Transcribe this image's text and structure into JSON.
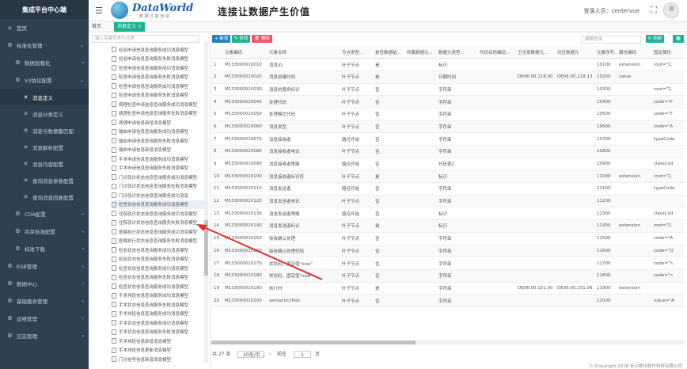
{
  "sidebar": {
    "brand": "集成平台中心端",
    "items": [
      {
        "label": "首页",
        "level": 1,
        "icon": "home-icon",
        "glyph": "⌂",
        "arrow": ""
      },
      {
        "label": "标准化管理",
        "level": 1,
        "icon": "gear-icon",
        "glyph": "⚙",
        "arrow": "⌄"
      },
      {
        "label": "数据加载化",
        "level": 2,
        "icon": "gear-icon",
        "glyph": "⚙",
        "arrow": "‹"
      },
      {
        "label": "V3协议配置",
        "level": 2,
        "icon": "gear-icon",
        "glyph": "⚙",
        "arrow": "⌄"
      },
      {
        "label": "消息定义",
        "level": 3,
        "icon": "tool-icon",
        "glyph": "✕",
        "arrow": "",
        "active": true
      },
      {
        "label": "消息分类定义",
        "level": 3,
        "icon": "tool-icon",
        "glyph": "✕",
        "arrow": ""
      },
      {
        "label": "消息与数据集匹配",
        "level": 3,
        "icon": "tool-icon",
        "glyph": "✕",
        "arrow": ""
      },
      {
        "label": "消息解析配置",
        "level": 3,
        "icon": "tool-icon",
        "glyph": "✕",
        "arrow": ""
      },
      {
        "label": "消息内容配置",
        "level": 3,
        "icon": "tool-icon",
        "glyph": "✕",
        "arrow": ""
      },
      {
        "label": "查询消息参数配置",
        "level": 3,
        "icon": "tool-icon",
        "glyph": "✕",
        "arrow": ""
      },
      {
        "label": "查询消息回复配置",
        "level": 3,
        "icon": "tool-icon",
        "glyph": "✕",
        "arrow": ""
      },
      {
        "label": "CDA配置",
        "level": 2,
        "icon": "gear-icon",
        "glyph": "⚙",
        "arrow": "‹"
      },
      {
        "label": "共享标准配置",
        "level": 2,
        "icon": "gear-icon",
        "glyph": "⚙",
        "arrow": "‹"
      },
      {
        "label": "标准下载",
        "level": 2,
        "icon": "gear-icon",
        "glyph": "⚙",
        "arrow": "‹"
      },
      {
        "label": "ESB管理",
        "level": 1,
        "icon": "gear-icon",
        "glyph": "⚙",
        "arrow": "‹"
      },
      {
        "label": "数据中心",
        "level": 1,
        "icon": "gear-icon",
        "glyph": "⚙",
        "arrow": "‹"
      },
      {
        "label": "基础服务管理",
        "level": 1,
        "icon": "gear-icon",
        "glyph": "⚙",
        "arrow": "‹"
      },
      {
        "label": "运维管理",
        "level": 1,
        "icon": "gear-icon",
        "glyph": "⚙",
        "arrow": "‹"
      },
      {
        "label": "日志管理",
        "level": 1,
        "icon": "gear-icon",
        "glyph": "⚙",
        "arrow": "‹"
      }
    ]
  },
  "header": {
    "logo_text": "DataWorld",
    "logo_sub": "数 据 才 能 创 造",
    "slogan": "连接让数据产生价值",
    "login_label": "登录人员：centervue"
  },
  "tabs": {
    "home": "首页",
    "current": "消息定义 ×"
  },
  "tree": {
    "placeholder": "输入关键字进行过滤",
    "nodes": [
      "检验申请信息查询服务成功消息模型",
      "检验申请信息查询服务失败消息模型",
      "检查申请信息查询服务成功消息模型",
      "检查申请信息查询服务失败消息模型",
      "检查申请信息查询服务成功消息模型",
      "检查申请信息查询服务失败消息模型",
      "病理检查申请信息查询服务成功消息模型",
      "病理检查申请信息查询服务失败消息模型",
      "病理申请信息新增消息模型",
      "输血申请信息查询服务成功消息模型",
      "输血申请信息查询服务失败消息模型",
      "输血申请信息新增消息模型",
      "手术申请信息查询服务成功消息模型",
      "手术申请信息查询服务失败消息模型",
      "门诊就诊状态信息查询服务成功消息模型",
      "门诊就诊状态信息查询服务失败消息模型",
      "门诊就诊状态信息查询服务成功消息",
      "检查状态信息查询服务成功消息模型",
      "住院就诊状态信息查询服务成功消息模型",
      "住院就诊状态信息查询服务失败消息模型",
      "医嘱执行状态信息查询服务成功消息模型",
      "医嘱执行状态信息查询服务失败消息模型",
      "检验状态信息查询服务成功消息模型",
      "检验状态信息查询服务失败消息模型",
      "检查状态信息查询服务成功消息模型",
      "检查状态信息查询服务失败消息模型",
      "检查状态信息查询服务成功消息模型",
      "手术排班信息查询服务成功消息模型",
      "手术状态信息查询服务失败消息模型",
      "手术排班信息查询服务成功消息模型",
      "手术状态信息查询服务成功消息模型",
      "手术状态信息查询服务失败消息模型",
      "手术排班信息新增消息模型",
      "手术排班信息更新消息模型",
      "门诊挂号信息新增消息模型"
    ],
    "selected": 17
  },
  "toolbar": {
    "add": "+ 新增",
    "edit": "✎ 修改",
    "del": "🗑 删除",
    "search_placeholder": "模糊查询",
    "search_btn": "⟳ 刷新",
    "cols_btn": "▦"
  },
  "table": {
    "headers": [
      "",
      "元素编码",
      "元素名称",
      "节点类型...",
      "是否数据结...",
      "所属数据元...",
      "数据元类型...",
      "代码名称编码...",
      "卫生部数据元...",
      "对应数据元",
      "元素序号...",
      "属性编码",
      "固定属性"
    ],
    "rows": [
      [
        "1",
        "M133000010010",
        "消息ID",
        "叶子节点",
        "是",
        "",
        "标识",
        "",
        "",
        "",
        "10100",
        "extension",
        "root=\"2."
      ],
      [
        "2",
        "M133000010020",
        "消息创建时间",
        "叶子节点",
        "是",
        "",
        "日期时间",
        "",
        "DE06.00.218.00",
        "DE06.00.218.13",
        "10200",
        "value",
        ""
      ],
      [
        "3",
        "M133000010030",
        "消息的服务标识",
        "叶子节点",
        "否",
        "",
        "字符串",
        "",
        "",
        "",
        "10300",
        "",
        "root=\"2."
      ],
      [
        "4",
        "M133000010040",
        "处理代码",
        "叶子节点",
        "否",
        "",
        "字符串",
        "",
        "",
        "",
        "10400",
        "",
        "code=\"P"
      ],
      [
        "5",
        "M133000010050",
        "处理模式代码",
        "叶子节点",
        "否",
        "",
        "字符串",
        "",
        "",
        "",
        "10500",
        "",
        "code=\"T"
      ],
      [
        "6",
        "M133000010060",
        "消息类型",
        "叶子节点",
        "否",
        "",
        "字符串",
        "",
        "",
        "",
        "10600",
        "",
        "code=\"A"
      ],
      [
        "7",
        "M133000010070",
        "消息接收者",
        "路径开始",
        "否",
        "",
        "字符串",
        "",
        "",
        "",
        "10700",
        "",
        "typeCode"
      ],
      [
        "8",
        "M133000010080",
        "消息接收者电讯",
        "叶子节点",
        "否",
        "",
        "字符串",
        "",
        "",
        "",
        "10800",
        "",
        ""
      ],
      [
        "9",
        "M133000010090",
        "消息接收者策略",
        "路径开始",
        "否",
        "",
        "代码表2",
        "",
        "",
        "",
        "10900",
        "",
        "classCod"
      ],
      [
        "10",
        "M133000010100",
        "消息接收者标识符",
        "叶子节点",
        "是",
        "",
        "标识",
        "",
        "",
        "",
        "11000",
        "extension",
        "root=\"2."
      ],
      [
        "11",
        "M133000010110",
        "消息发送者",
        "路径开始",
        "否",
        "",
        "字符串",
        "",
        "",
        "",
        "11100",
        "",
        "typeCode"
      ],
      [
        "12",
        "M133000010120",
        "消息发送者电讯",
        "叶子节点",
        "否",
        "",
        "字符串",
        "",
        "",
        "",
        "11200",
        "",
        ""
      ],
      [
        "13",
        "M133000010130",
        "消息发送者策略",
        "路径开始",
        "否",
        "",
        "标识",
        "",
        "",
        "",
        "11300",
        "",
        "classCod"
      ],
      [
        "14",
        "M133000010140",
        "消息发送者标识",
        "叶子节点",
        "是",
        "",
        "标识",
        "",
        "",
        "",
        "11400",
        "extension",
        "root=\"2."
      ],
      [
        "15",
        "M133000010150",
        "接收确认处理",
        "叶子节点",
        "否",
        "",
        "字符串",
        "",
        "",
        "",
        "11500",
        "",
        "code=\"A"
      ],
      [
        "16",
        "M133000010160",
        "接收确认处理代码",
        "叶子节点",
        "否",
        "",
        "字符串",
        "",
        "",
        "",
        "11600",
        "",
        "code=\"Q"
      ],
      [
        "17",
        "M133000010170",
        "状态码，固定值\"new\"",
        "叶子节点",
        "否",
        "",
        "字符串",
        "",
        "",
        "",
        "11700",
        "",
        "code=\"n"
      ],
      [
        "18",
        "M133000010180",
        "状态码，固定值\"new\"",
        "叶子节点",
        "否",
        "",
        "字符串",
        "",
        "",
        "",
        "11800",
        "",
        "code=\"n"
      ],
      [
        "19",
        "M133000010190",
        "执行时",
        "叶子节点",
        "是",
        "",
        "字符串",
        "",
        "DE06.00.151.00",
        "DE06.00.151.06",
        "11900",
        "extension",
        ""
      ],
      [
        "20",
        "M133000010200",
        "semanticsText",
        "叶子节点",
        "否",
        "",
        "字符串",
        "",
        "",
        "",
        "12000",
        "",
        "value=\"A"
      ]
    ]
  },
  "pager": {
    "total": "共 27 条",
    "size": "20条/页 ⌄",
    "prev": "‹",
    "prev_text": "前往",
    "page": "1",
    "unit": "页"
  },
  "footer": "© Copyright 2018 长沙数讯软件科技有限公司"
}
